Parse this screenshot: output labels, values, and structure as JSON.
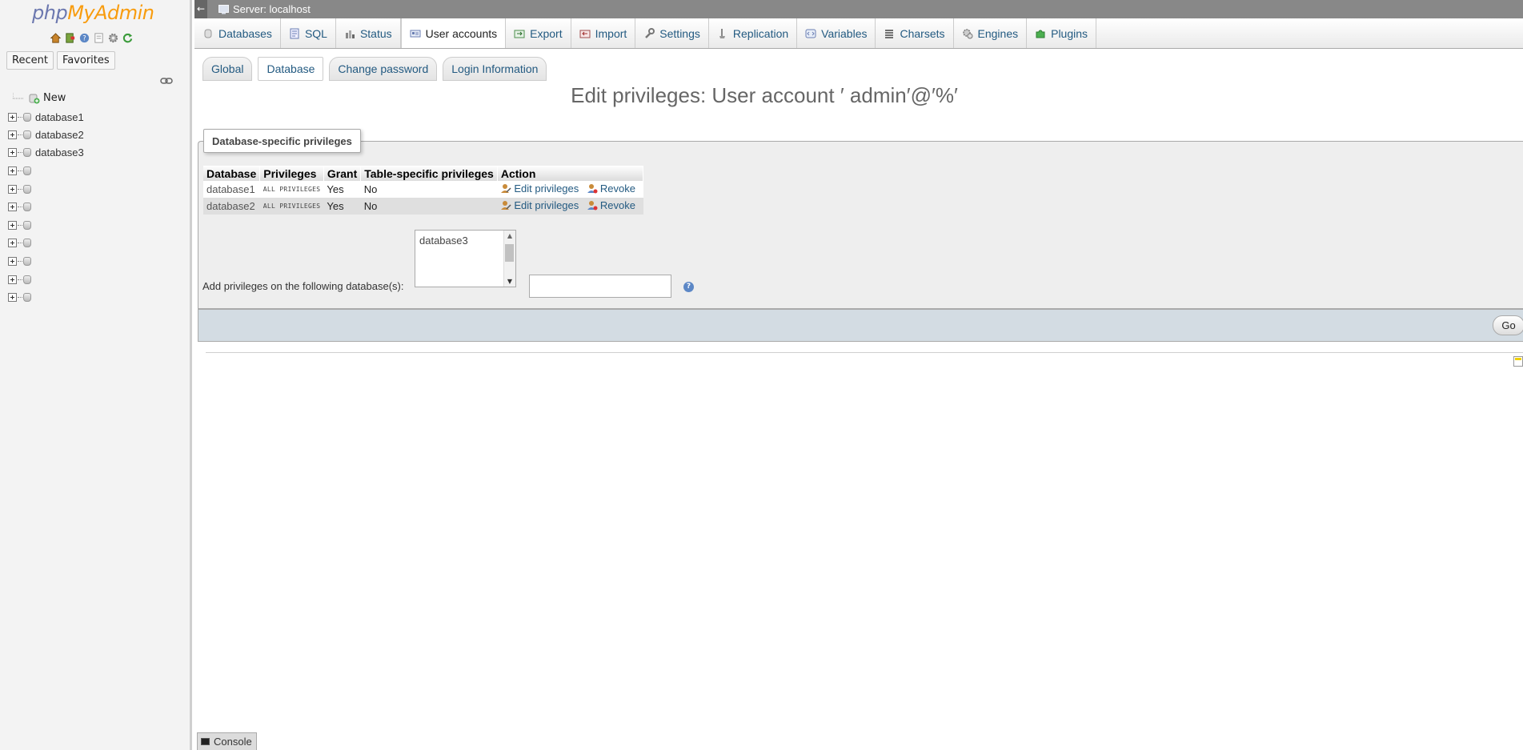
{
  "nav": {
    "logo_php": "php",
    "logo_myadmin": "MyAdmin",
    "icons": [
      "home-icon",
      "exit-icon",
      "docs-icon",
      "sql-docs-icon",
      "settings-icon",
      "reload-icon"
    ],
    "tabs": [
      "Recent",
      "Favorites"
    ],
    "tree_new": "New",
    "databases": [
      "database1",
      "database2",
      "database3",
      "",
      "",
      "",
      "",
      "",
      "",
      "",
      ""
    ]
  },
  "topbar": {
    "back": "←",
    "server": "Server: localhost"
  },
  "tabs": [
    {
      "label": "Databases",
      "icon": "database-icon"
    },
    {
      "label": "SQL",
      "icon": "sql-icon"
    },
    {
      "label": "Status",
      "icon": "status-icon"
    },
    {
      "label": "User accounts",
      "icon": "users-icon",
      "active": true
    },
    {
      "label": "Export",
      "icon": "export-icon"
    },
    {
      "label": "Import",
      "icon": "import-icon"
    },
    {
      "label": "Settings",
      "icon": "wrench-icon"
    },
    {
      "label": "Replication",
      "icon": "replication-icon"
    },
    {
      "label": "Variables",
      "icon": "variables-icon"
    },
    {
      "label": "Charsets",
      "icon": "charsets-icon"
    },
    {
      "label": "Engines",
      "icon": "engines-icon"
    },
    {
      "label": "Plugins",
      "icon": "plugins-icon"
    }
  ],
  "subtabs": [
    {
      "label": "Global"
    },
    {
      "label": "Database",
      "active": true
    },
    {
      "label": "Change password"
    },
    {
      "label": "Login Information"
    }
  ],
  "page_title": "Edit privileges: User account ′ admin′@′%′",
  "fieldset": {
    "legend": "Database-specific privileges",
    "columns": [
      "Database",
      "Privileges",
      "Grant",
      "Table-specific privileges",
      "Action"
    ],
    "rows": [
      {
        "database": "database1",
        "privileges": "ALL PRIVILEGES",
        "grant": "Yes",
        "table_specific": "No",
        "edit": "Edit privileges",
        "revoke": "Revoke"
      },
      {
        "database": "database2",
        "privileges": "ALL PRIVILEGES",
        "grant": "Yes",
        "table_specific": "No",
        "edit": "Edit privileges",
        "revoke": "Revoke"
      }
    ],
    "add_label": "Add privileges on the following database(s):",
    "db_options": [
      "database3"
    ],
    "help": "?"
  },
  "go_label": "Go",
  "console_label": "Console"
}
